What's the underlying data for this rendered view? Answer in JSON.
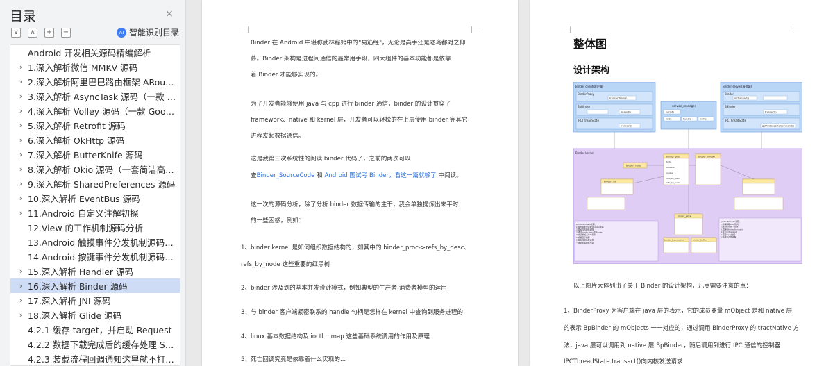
{
  "toc": {
    "title": "目录",
    "close": "×",
    "tools": [
      "∨",
      "∧",
      "+",
      "−"
    ],
    "ai_label": "智能识别目录",
    "ai_icon_text": "AI",
    "items": [
      {
        "level": 0,
        "label": "Android 开发相关源码精编解析",
        "arrow": "",
        "active": false
      },
      {
        "level": 1,
        "label": "1.深入解析微信  MMKV  源码",
        "arrow": "›",
        "active": false
      },
      {
        "level": 1,
        "label": "2.深入解析阿里巴巴路由框架 ARoute...",
        "arrow": "›",
        "active": false
      },
      {
        "level": 1,
        "label": "3.深入解析 AsyncTask  源码（一款 A...",
        "arrow": "›",
        "active": false
      },
      {
        "level": 1,
        "label": "4.深入解析 Volley  源码（一款 Googl...",
        "arrow": "›",
        "active": false
      },
      {
        "level": 1,
        "label": "5.深入解析  Retrofit 源码",
        "arrow": "›",
        "active": false
      },
      {
        "level": 1,
        "label": "6.深入解析 OkHttp  源码",
        "arrow": "›",
        "active": false
      },
      {
        "level": 1,
        "label": "7.深入解析 ButterKnife  源码",
        "arrow": "›",
        "active": false
      },
      {
        "level": 1,
        "label": "8.深入解析 Okio 源码（一套简洁高效...",
        "arrow": "›",
        "active": false
      },
      {
        "level": 1,
        "label": "9.深入解析 SharedPreferences 源码",
        "arrow": "›",
        "active": false
      },
      {
        "level": 1,
        "label": "10.深入解析 EventBus  源码",
        "arrow": "›",
        "active": false
      },
      {
        "level": 1,
        "label": "11.Android  自定义注解初探",
        "arrow": "›",
        "active": false
      },
      {
        "level": 2,
        "label": "12.View  的工作机制源码分析",
        "arrow": "",
        "active": false
      },
      {
        "level": 2,
        "label": "13.Android  触摸事件分发机制源码分...",
        "arrow": "",
        "active": false
      },
      {
        "level": 2,
        "label": "14.Android  按键事件分发机制源码分...",
        "arrow": "",
        "active": false
      },
      {
        "level": 1,
        "label": "15.深入解析    Handler  源码",
        "arrow": "›",
        "active": false
      },
      {
        "level": 1,
        "label": "16.深入解析 Binder 源码",
        "arrow": "›",
        "active": true
      },
      {
        "level": 1,
        "label": "17.深入解析 JNI  源码",
        "arrow": "›",
        "active": false
      },
      {
        "level": 1,
        "label": "18.深入解析 Glide 源码",
        "arrow": "›",
        "active": false
      },
      {
        "level": 3,
        "label": "4.2.1  缓存 target，并启动 Request",
        "arrow": "",
        "active": false
      },
      {
        "level": 3,
        "label": "4.2.2  数据下载完成后的缓存处理 Sou...",
        "arrow": "",
        "active": false
      },
      {
        "level": 3,
        "label": "4.2.3  装载流程回调通知这里就不打算...",
        "arrow": "",
        "active": false
      }
    ]
  },
  "page1": {
    "para1": [
      "Binder 在 Android 中堪称武林秘籍中的\"易筋经\"，无论是高手还是老鸟都对之仰",
      "慕。Binder 架构是进程间通信的最常用手段，四大组件的基本功能都是依靠",
      "着 Binder 才能够实现的。"
    ],
    "para2": [
      "为了开发者能够使用 java 与 cpp 进行 binder 通信，binder 的设计贯穿了",
      "framework、native 和 kernel 层，开发者可以轻松的在上层使用 binder 完其它",
      "进程发起数据通信。"
    ],
    "para3_line1": "这是我第三次系统性的阅读 binder 代码了，之前的两次可以",
    "para3_pre": "查",
    "para3_link1": "Binder_SourceCode",
    "para3_mid": " 和 ",
    "para3_link2": "Android 图试考 Binder",
    "para3_mid2": "，看这一篇就够了",
    "para3_post": " 中阅读。",
    "para4": [
      "这一次的源码分析，除了分析 binder 数据传输的主干，我会单独提炼出来平时",
      "的一些困惑，例如："
    ],
    "list": [
      [
        "1、binder kernel 是如何组织数据结构的，如其中的 binder_proc->refs_by_desc、",
        "refs_by_node 这些重要的红黑树"
      ],
      [
        "2、binder 涉及到的基本并发设计模式，例如典型的生产者-消费者模型的运用"
      ],
      [
        "3、与 binder 客户端紧密联系的 handle 句柄是怎样在 kernel 中查询到服务进程的"
      ],
      [
        "4、linux  基本数据结构及 ioctl  mmap 这些基础系统调用的作用及原理"
      ],
      [
        "5、死亡回调究竟是依靠着什么实现的..."
      ]
    ]
  },
  "page2": {
    "heading1": "整体图",
    "heading2": "设计架构",
    "caption": "以上图片大体列出了关于 Binder 的设计架构，几点需要注意的点：",
    "point1": [
      "1、BinderProxy 为客户端在 java 层的表示，它的成员变量 mObject 是和 native 层",
      "的表示 BpBinder 的 mObjects 一一对应的，通过调用 BinderProxy 的 tractNative 方",
      "法，java 层可以调用到 native 层 BpBinder，随后调用到进行 IPC 通信的控制器",
      "IPCThreadState.transact()向内核发送请求"
    ]
  },
  "diagram": {
    "left_box_title": "Binder client(客户端)",
    "right_box_title": "Binder server(服务端)",
    "left_items": [
      "BinderProxy",
      "BpBinder",
      "IPCThreadState"
    ],
    "right_items": [
      "Binder",
      "BBinder",
      "IPCThreadState"
    ],
    "left_values": [
      "transactNative",
      "mHandle",
      "transact()"
    ],
    "right_values": [
      "onTransact()",
      "transact()",
      "getAndExecuteCommand()"
    ],
    "mid_title": "service_manager",
    "mid_items": [
      "svcinfo",
      "node",
      "handle",
      "name"
    ],
    "kernel_title": "Binder kernel",
    "kernel_nodes": [
      "binder_proc",
      "binder_node",
      "binder_ref",
      "binder_thread",
      "todo",
      "threads",
      "nodes",
      "refs_by_desc",
      "refs_by_node",
      "binder_work",
      "binder_transaction",
      "binder_buffer"
    ],
    "notes_left": "sendCommand流程：\n1.服务端发送请求到binder驱动\n2.驱动找到目标进程\n3.通过binder_proc找到node\n4.将请求加入todo队列\n5.唤醒目标线程\n6.目标线程处理请求\n7.将结果返回客户端",
    "notes_right": "getAndExecute流程：\n1.线程读取todo队列\n2.解析binder_work\n3.调用BBinder transact\n4.执行onTransact\n5.返回reply数据\n6.唤醒客户端线程"
  },
  "colors": {
    "active_bg": "#cfdcf6",
    "link": "#2c6fd6",
    "diagram_blue": "#b9d6f6",
    "diagram_purple": "#e0cdf6",
    "diagram_yellow": "#fbe7a2"
  }
}
